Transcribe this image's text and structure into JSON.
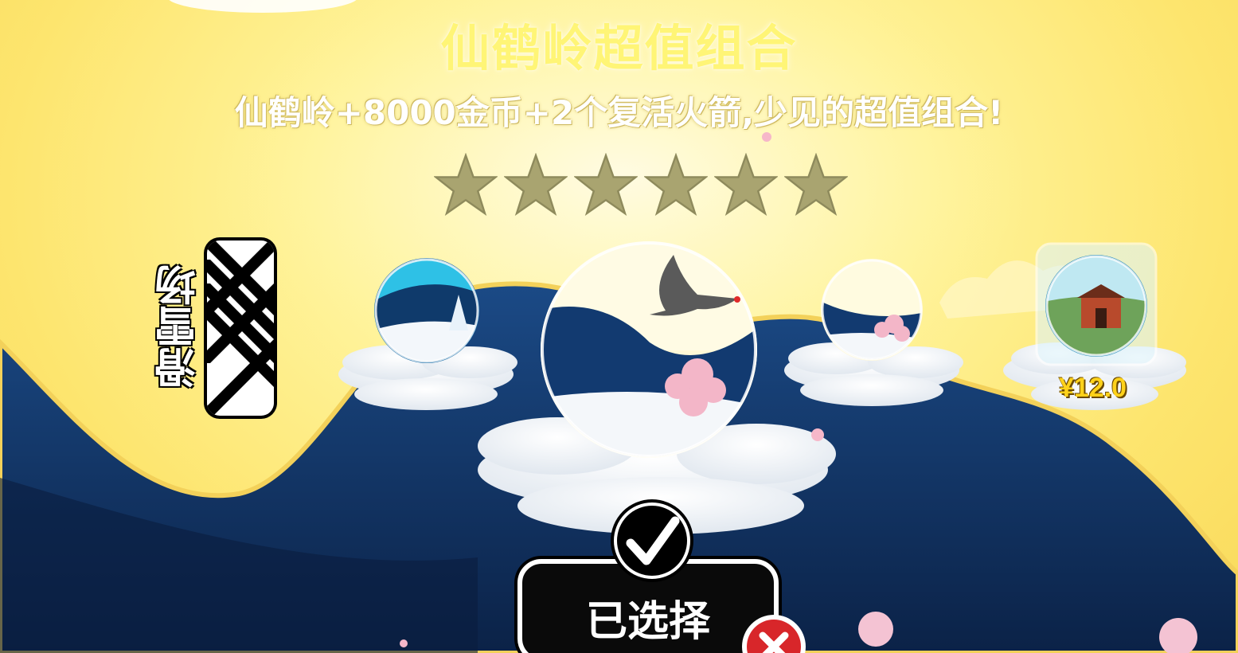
{
  "pack": {
    "title": "仙鹤岭超值组合",
    "description": "仙鹤岭+8000金币+2个复活火箭,少见的超值组合!",
    "rating_stars": 6
  },
  "nav": {
    "swipe_hint": "滑雪场"
  },
  "scenes": [
    {
      "name": "snow-tree-scene",
      "locked": false
    },
    {
      "name": "crane-ridge-scene",
      "locked": false,
      "selected": true
    },
    {
      "name": "blossom-scene",
      "locked": false
    },
    {
      "name": "temple-scene",
      "locked": true,
      "price": "¥12.0"
    }
  ],
  "actions": {
    "selected_label": "已选择"
  },
  "colors": {
    "sky": "#fde56e",
    "mountain": "#0f2e5e",
    "title": "#fff576",
    "price": "#ffd21a"
  }
}
